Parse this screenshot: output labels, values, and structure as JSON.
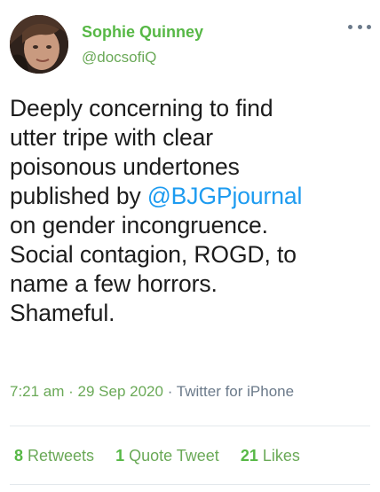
{
  "user": {
    "display_name": "Sophie Quinney",
    "handle": "@docsofiQ",
    "avatar_icon": "profile-photo"
  },
  "tweet": {
    "lines": [
      {
        "text": "Deeply concerning to find"
      },
      {
        "text": "utter tripe with clear"
      },
      {
        "text": "poisonous undertones"
      },
      {
        "before": "published by ",
        "mention": "@BJGPjournal"
      },
      {
        "text": "on gender incongruence."
      },
      {
        "text": "Social contagion, ROGD, to"
      },
      {
        "text": "name a few horrors."
      },
      {
        "text": "Shameful."
      }
    ]
  },
  "meta": {
    "timestamp": "7:21 am · 29 Sep 2020",
    "separator": "·",
    "source": "Twitter for iPhone"
  },
  "stats": {
    "retweets": {
      "count": "8",
      "label": "Retweets"
    },
    "quotes": {
      "count": "1",
      "label": "Quote Tweet"
    },
    "likes": {
      "count": "21",
      "label": "Likes"
    }
  },
  "icons": {
    "more": "more-options-icon"
  },
  "colors": {
    "name_green": "#57b846",
    "handle_green": "#6aa957",
    "mention_blue": "#1d9bf0",
    "muted_gray": "#6b7a8a",
    "text": "#1c1c1c"
  }
}
